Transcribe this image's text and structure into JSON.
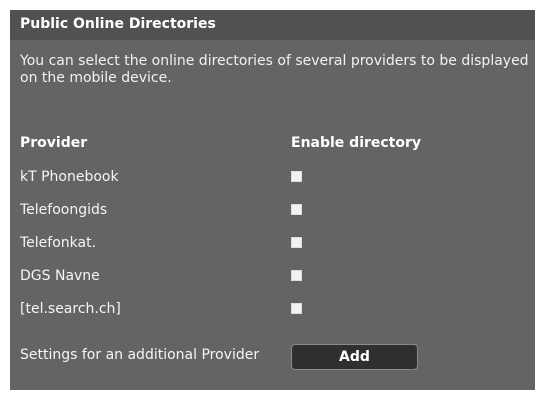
{
  "section": {
    "title": "Public Online Directories",
    "description": "You can select the online directories of several providers to be displayed on the mobile device."
  },
  "table": {
    "provider_header": "Provider",
    "enable_header": "Enable directory",
    "rows": [
      {
        "provider": "kT Phonebook",
        "enabled": false
      },
      {
        "provider": "Telefoongids",
        "enabled": false
      },
      {
        "provider": "Telefonkat.",
        "enabled": false
      },
      {
        "provider": "DGS Navne",
        "enabled": false
      },
      {
        "provider": "[tel.search.ch]",
        "enabled": false
      }
    ]
  },
  "additional": {
    "label": "Settings for an additional Provider",
    "button_label": "Add"
  },
  "colors": {
    "panel_bg": "#646464",
    "header_bg": "#515151",
    "button_bg": "#2f2f2f"
  }
}
